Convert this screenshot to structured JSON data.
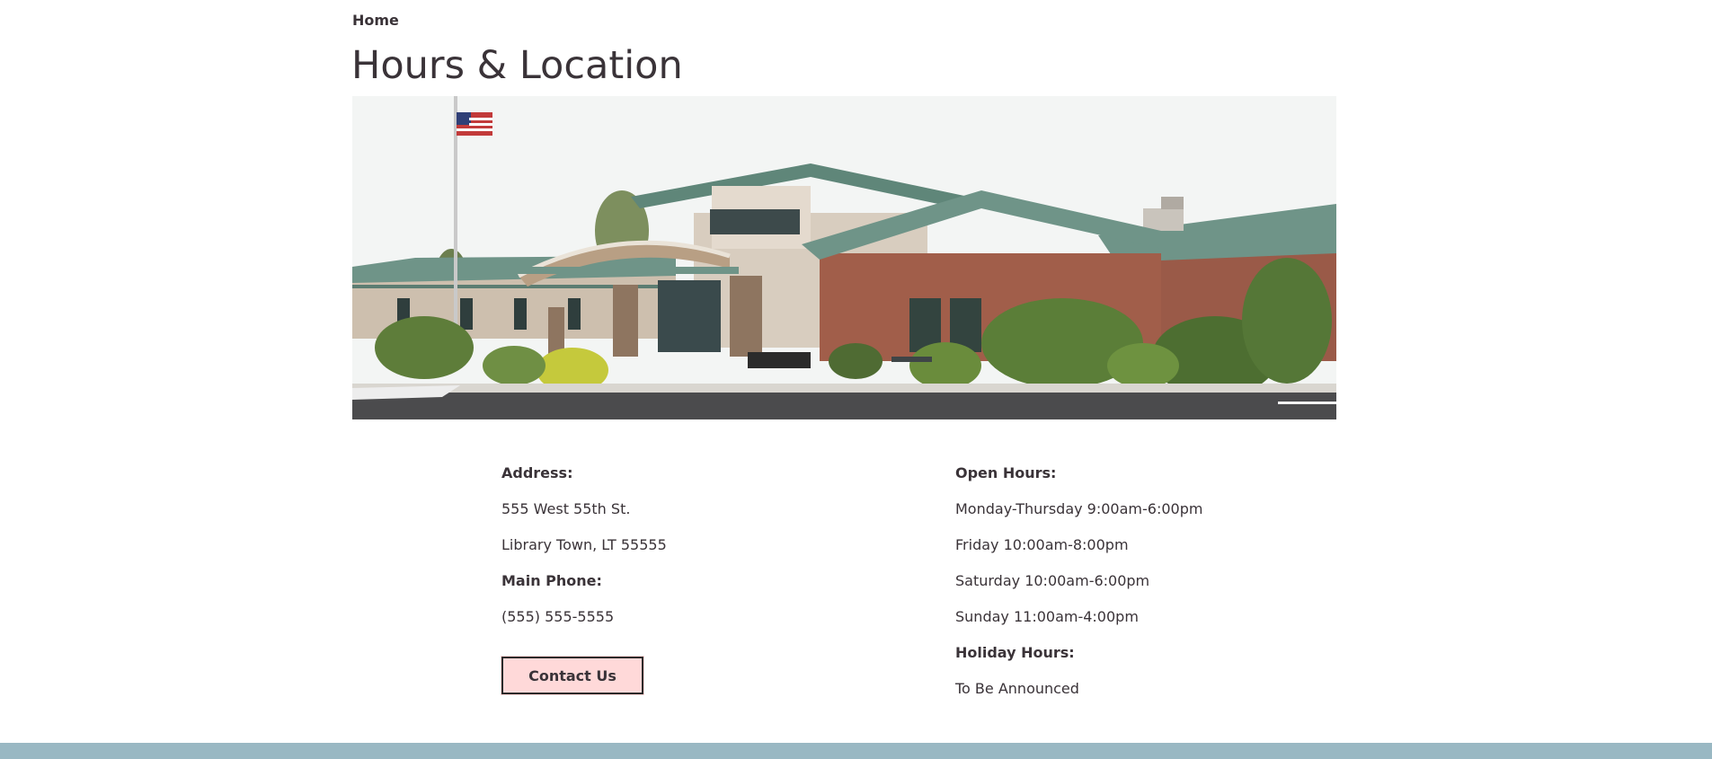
{
  "breadcrumb": {
    "home_label": "Home"
  },
  "page": {
    "title": "Hours & Location"
  },
  "hero": {
    "image_icon": "library-building-photo"
  },
  "address_block": {
    "address_heading": "Address:",
    "street": "555 West 55th St.",
    "city_line": "Library Town, LT 55555",
    "phone_heading": "Main Phone:",
    "phone": "(555) 555-5555",
    "contact_button_label": "Contact Us"
  },
  "hours_block": {
    "open_heading": "Open Hours:",
    "hours": [
      "Monday-Thursday 9:00am-6:00pm",
      "Friday 10:00am-8:00pm",
      "Saturday 10:00am-6:00pm",
      "Sunday 11:00am-4:00pm"
    ],
    "holiday_heading": "Holiday Hours:",
    "holiday_value": "To Be Announced"
  },
  "colors": {
    "text": "#3a3338",
    "button_bg": "#ffd9d9",
    "footer": "#99b8c3",
    "roof": "#6f9488"
  }
}
